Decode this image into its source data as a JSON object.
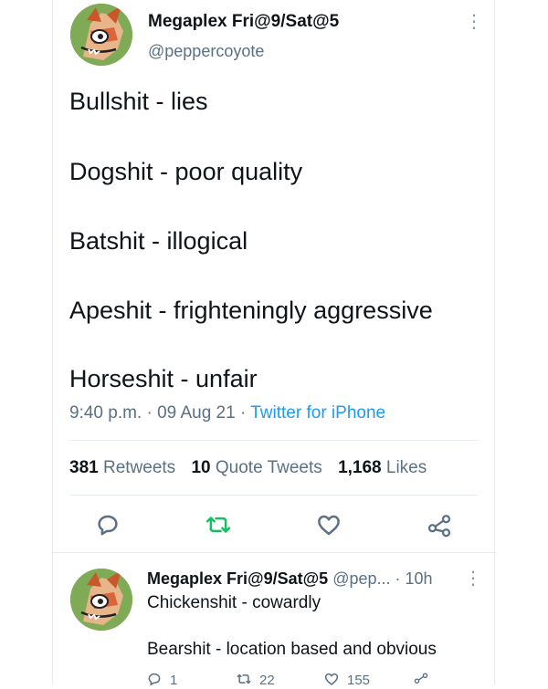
{
  "tweet": {
    "display_name": "Megaplex Fri@9/Sat@5",
    "handle": "@peppercoyote",
    "lines": [
      "Bullshit - lies",
      "Dogshit - poor quality",
      "Batshit - illogical",
      "Apeshit - frighteningly aggressive",
      "Horseshit - unfair"
    ],
    "time": "9:40 p.m.",
    "date": "09 Aug 21",
    "source": "Twitter for iPhone",
    "retweets_count": "381",
    "retweets_label": "Retweets",
    "quotes_count": "10",
    "quotes_label": "Quote Tweets",
    "likes_count": "1,168",
    "likes_label": "Likes"
  },
  "reply": {
    "display_name": "Megaplex Fri@9/Sat@5",
    "handle": "@pep...",
    "age": "10h",
    "line1": "Chickenshit - cowardly",
    "line2": "Bearshit - location based and obvious",
    "reply_count": "1",
    "retweet_count": "22",
    "like_count": "155"
  },
  "icons": [
    "more-icon",
    "reply-icon",
    "retweet-icon",
    "like-icon",
    "share-icon"
  ],
  "colors": {
    "accent": "#1d9bf0",
    "retweet": "#17bf63",
    "muted": "#5b7083",
    "text": "#0f1419"
  }
}
